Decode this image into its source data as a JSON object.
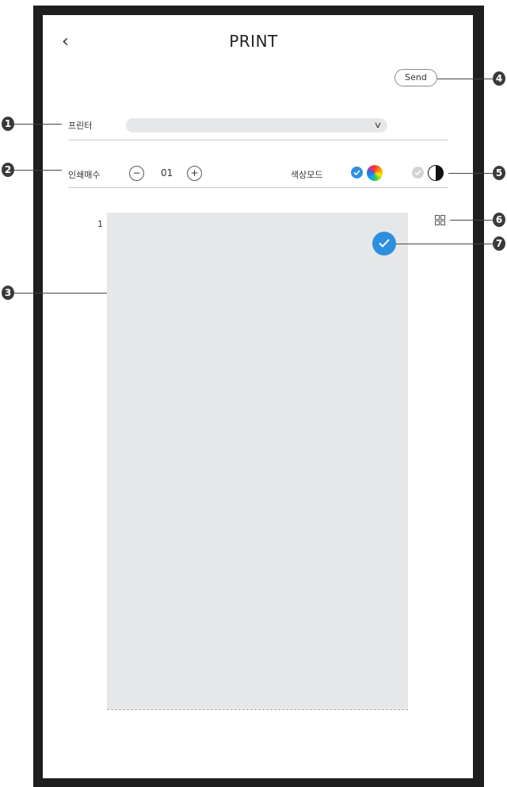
{
  "header": {
    "back_icon": "chevron-left-icon",
    "back_glyph": "‹",
    "title": "PRINT",
    "send_label": "Send"
  },
  "printer": {
    "label": "프린터",
    "selected_value": "",
    "dropdown_icon": "chevron-down-icon",
    "dropdown_glyph": "∨"
  },
  "copies": {
    "label": "인쇄매수",
    "decrement_glyph": "−",
    "value": "01",
    "increment_glyph": "+"
  },
  "color_mode": {
    "label": "색상모드",
    "options": [
      {
        "name": "color",
        "selected": true,
        "icon": "color-wheel-icon"
      },
      {
        "name": "black-white",
        "selected": false,
        "icon": "black-white-icon"
      }
    ]
  },
  "preview": {
    "page_number": "1",
    "selected": true,
    "view_toggle_icon": "grid-view-icon"
  },
  "callouts": {
    "badges": [
      "1",
      "2",
      "3",
      "4",
      "5",
      "6",
      "7"
    ]
  },
  "colors": {
    "accent": "#2d8fe0",
    "frame": "#1e1e1e",
    "preview_bg": "#e6e7e9",
    "callout": "#3a3a3a"
  }
}
